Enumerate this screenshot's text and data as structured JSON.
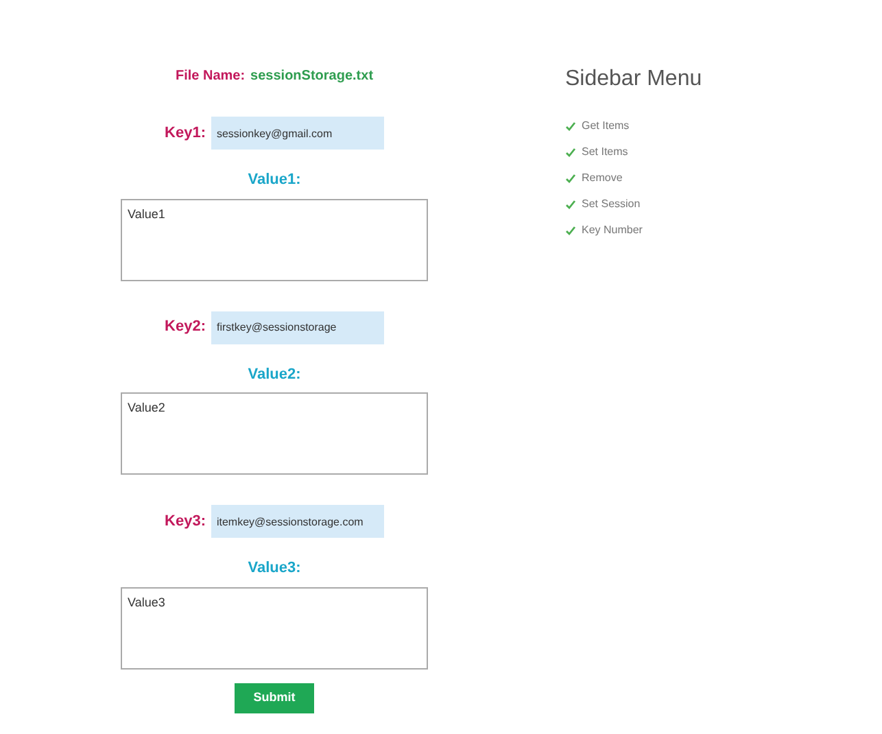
{
  "file_name": {
    "label": "File Name:",
    "value": "sessionStorage.txt"
  },
  "entries": [
    {
      "key_label": "Key1:",
      "key_value": "sessionkey@gmail.com",
      "value_label": "Value1:",
      "value_text": "Value1"
    },
    {
      "key_label": "Key2:",
      "key_value": "firstkey@sessionstorage",
      "value_label": "Value2:",
      "value_text": "Value2"
    },
    {
      "key_label": "Key3:",
      "key_value": "itemkey@sessionstorage.com",
      "value_label": "Value3:",
      "value_text": "Value3"
    }
  ],
  "submit_button": "Submit",
  "sidebar": {
    "title": "Sidebar Menu",
    "items": [
      "Get Items",
      "Set Items",
      "Remove",
      "Set Session",
      "Key Number"
    ]
  }
}
